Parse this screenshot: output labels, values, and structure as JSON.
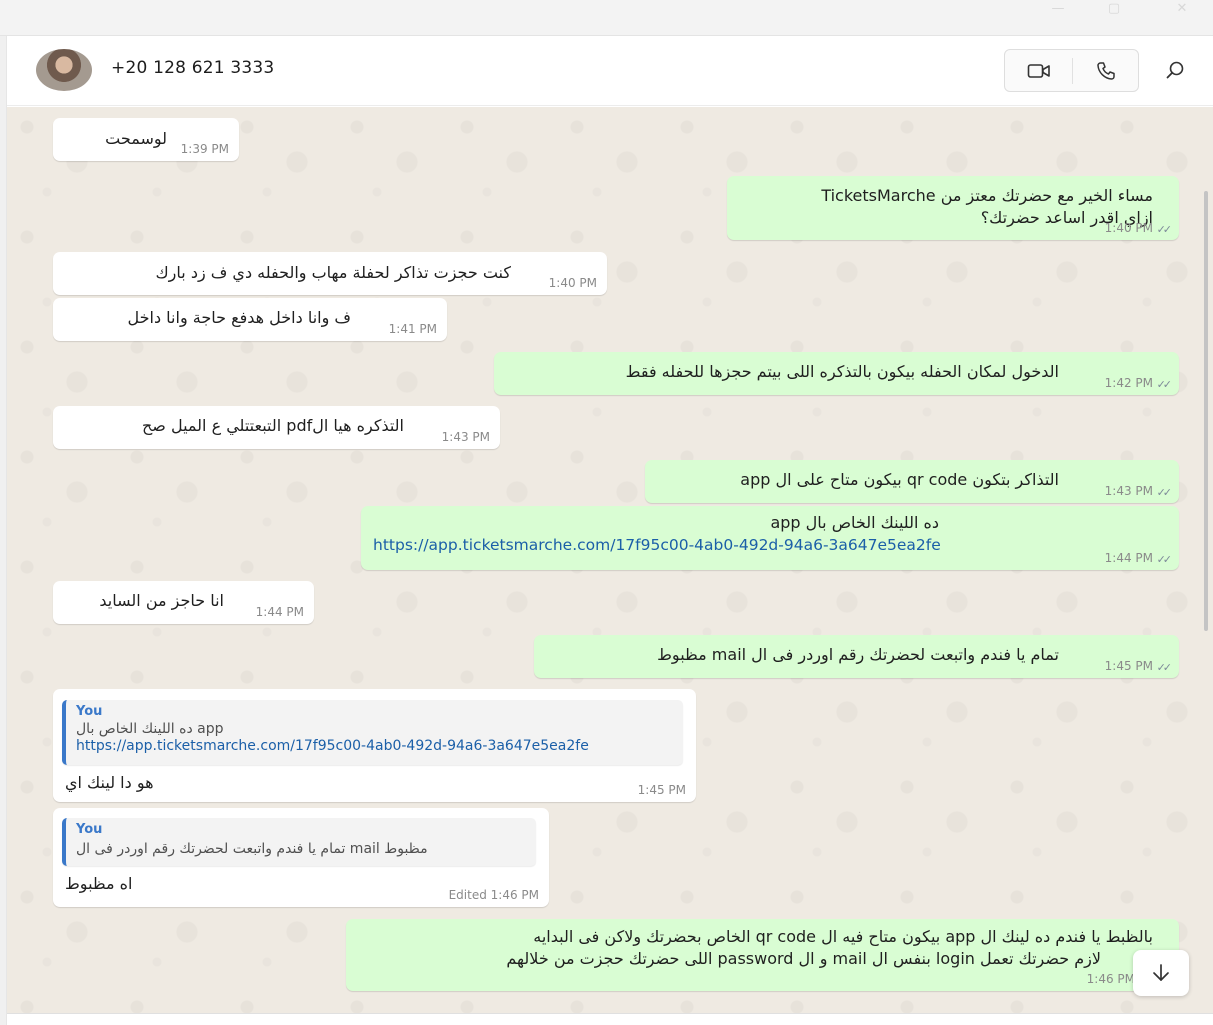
{
  "window": {
    "minimize": "—",
    "maximize": "▢",
    "close": "✕"
  },
  "header": {
    "contact": "+20 128 621 3333",
    "icons": {
      "video": "video-camera-icon",
      "voice": "phone-icon",
      "search": "search-icon"
    }
  },
  "messages": [
    {
      "dir": "in",
      "text": "لوسمحت",
      "time": "1:39 PM"
    },
    {
      "dir": "out",
      "lines": [
        "مساء الخير مع حضرتك معتز من TicketsMarche",
        "ازاي اقدر اساعد حضرتك؟"
      ],
      "time": "1:40 PM"
    },
    {
      "dir": "in",
      "text": "كنت حجزت تذاكر لحفلة مهاب والحفله دي ف زد بارك",
      "time": "1:40 PM"
    },
    {
      "dir": "in",
      "text": "ف وانا داخل هدفع حاجة وانا داخل",
      "time": "1:41 PM"
    },
    {
      "dir": "out",
      "text": "الدخول لمكان الحفله بيكون بالتذكره اللى بيتم حجزها للحفله فقط",
      "time": "1:42 PM"
    },
    {
      "dir": "in",
      "text": "التذكره هيا الpdf التبعتتلي ع الميل صح",
      "time": "1:43 PM"
    },
    {
      "dir": "out",
      "text": "التذاكر بتكون qr code بيكون متاح على ال app",
      "time": "1:43 PM"
    },
    {
      "dir": "out",
      "text": "ده اللينك الخاص بال app",
      "link": "https://app.ticketsmarche.com/17f95c00-4ab0-492d-94a6-3a647e5ea2fe",
      "time": "1:44 PM"
    },
    {
      "dir": "in",
      "text": "انا حاجز من السايد",
      "time": "1:44 PM"
    },
    {
      "dir": "out",
      "text": "تمام يا فندم واتبعت لحضرتك رقم اوردر فى ال mail مظبوط",
      "time": "1:45 PM"
    },
    {
      "dir": "in",
      "quote": {
        "author": "You",
        "text": "ده اللينك الخاص بال app",
        "link": "https://app.ticketsmarche.com/17f95c00-4ab0-492d-94a6-3a647e5ea2fe"
      },
      "text": "هو دا لينك اي",
      "time": "1:45 PM"
    },
    {
      "dir": "in",
      "quote": {
        "author": "You",
        "text": "تمام يا فندم واتبعت لحضرتك رقم اوردر فى ال mail مظبوط"
      },
      "text": "اه مظبوط",
      "time": "Edited 1:46 PM"
    },
    {
      "dir": "out",
      "lines": [
        "بالظبط يا فندم ده لينك ال app بيكون متاح فيه ال qr code الخاص بحضرتك ولاكن فى البدايه",
        "لازم  حضرتك تعمل login بنفس ال mail و ال password اللى حضرتك حجزت من خلالهم"
      ],
      "time": "1:46 PM"
    }
  ],
  "read_ticks": "✓✓",
  "colors": {
    "incoming": "#ffffff",
    "outgoing": "#d9fdd3",
    "link": "#1b5fa8",
    "quote_accent": "#3a78c9",
    "chat_bg": "#efeae2"
  }
}
